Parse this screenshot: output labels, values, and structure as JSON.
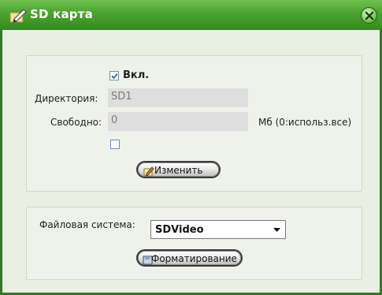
{
  "window": {
    "title": "SD карта",
    "close_icon": "close-icon"
  },
  "sd_panel": {
    "enable_label": "Вкл.",
    "enable_checked": true,
    "directory_label": "Директория:",
    "directory_value": "SD1",
    "free_label": "Свободно:",
    "free_value": "0",
    "free_unit": "Мб (0:использ.все)",
    "extra_checked": false,
    "change_button": "Изменить"
  },
  "fs_panel": {
    "fs_label": "Файловая система:",
    "fs_selected": "SDVideo",
    "format_button": "Форматирование"
  },
  "colors": {
    "titlebar": "#4aa22f",
    "border": "#2f7a22",
    "background": "#e9efe2"
  }
}
